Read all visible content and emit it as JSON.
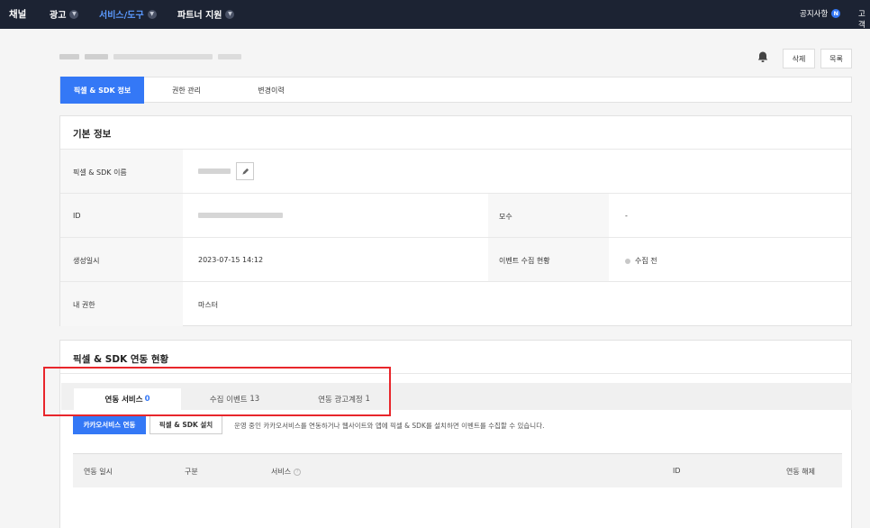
{
  "nav": {
    "brand": "채널",
    "items": [
      {
        "label": "광고"
      },
      {
        "label": "서비스/도구"
      },
      {
        "label": "파트너 지원"
      }
    ],
    "notice_label": "공지사항",
    "notice_badge": "N",
    "customer_label": "고객"
  },
  "header": {
    "delete_label": "삭제",
    "list_label": "목록"
  },
  "tabs": [
    {
      "label": "픽셀 & SDK 정보"
    },
    {
      "label": "권한 관리"
    },
    {
      "label": "변경이력"
    }
  ],
  "basic_info": {
    "title": "기본 정보",
    "rows": {
      "name_label": "픽셀 & SDK 이름",
      "id_label": "ID",
      "mother_label": "모수",
      "mother_value": "-",
      "created_label": "생성일시",
      "created_value": "2023-07-15 14:12",
      "event_status_label": "이벤트 수집 현황",
      "event_status_value": "수집 전",
      "permission_label": "내 권한",
      "permission_value": "마스터"
    }
  },
  "linkage": {
    "title": "픽셀 & SDK 연동 현황",
    "subtabs": [
      {
        "label": "연동 서비스",
        "count": "0"
      },
      {
        "label": "수집 이벤트",
        "count": "13"
      },
      {
        "label": "연동 광고계정",
        "count": "1"
      }
    ],
    "link_button": "카카오서비스 연동",
    "install_button": "픽셀 & SDK 설치",
    "info_text": "운영 중인 카카오서비스를 연동하거나 웹사이트와 앱에 픽셀 & SDK를 설치하면 이벤트를 수집할 수 있습니다.",
    "columns": [
      "연동 일시",
      "구분",
      "서비스",
      "ID",
      "연동 해제"
    ],
    "help_mark": "?"
  },
  "colors": {
    "nav_bg": "#1c2333",
    "accent": "#3478f6",
    "highlight": "#e8262b"
  }
}
